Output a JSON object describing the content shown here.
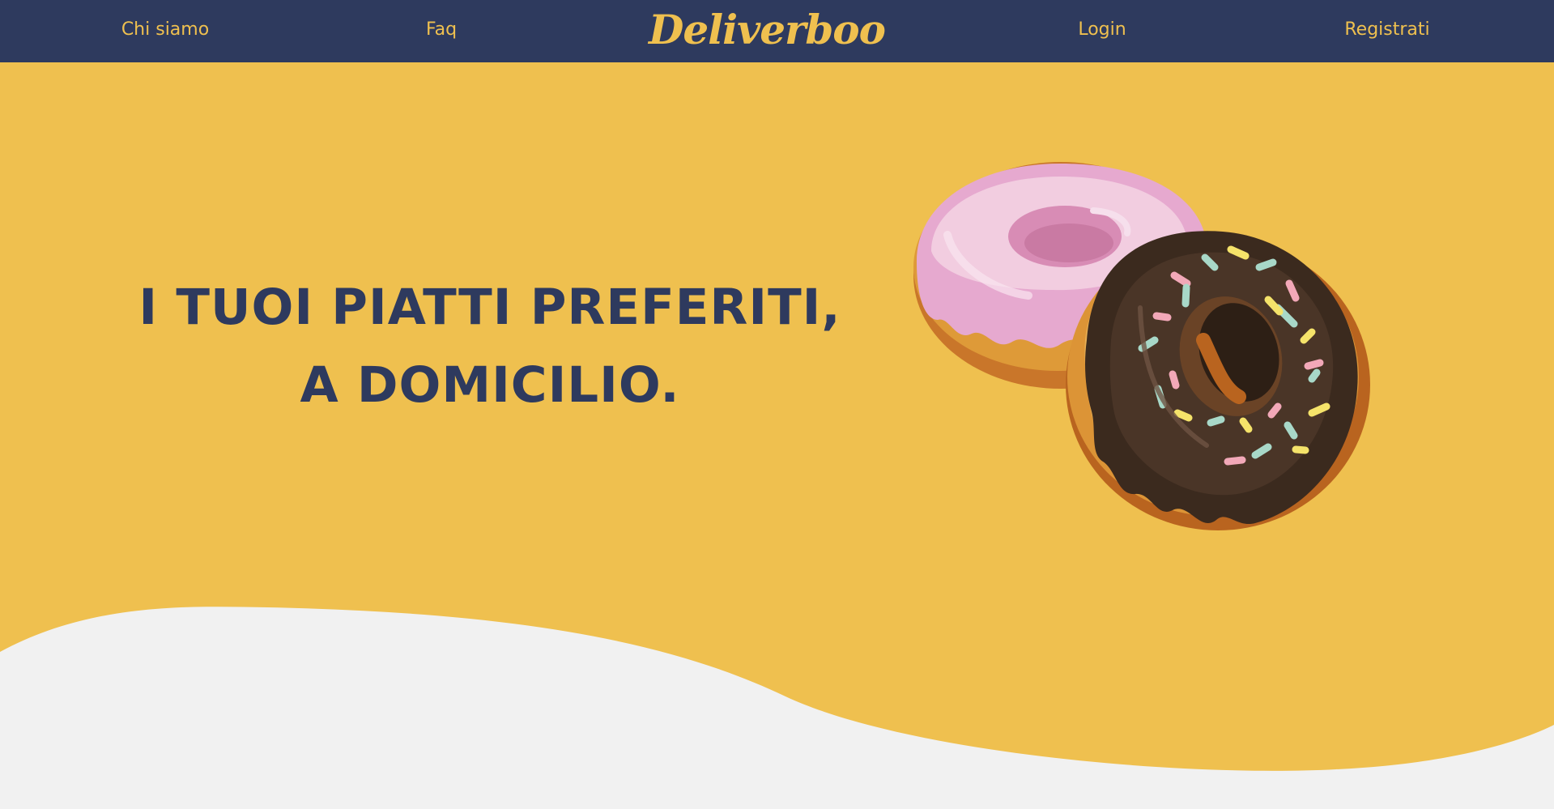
{
  "navbar": {
    "links": {
      "about": "Chi siamo",
      "faq": "Faq",
      "login": "Login",
      "register": "Registrati"
    },
    "logo": "Deliverboo"
  },
  "hero": {
    "headline_line1": "I TUOI PIATTI PREFERITI,",
    "headline_line2": "A DOMICILIO."
  },
  "colors": {
    "navbar_bg": "#2e3a5e",
    "accent_yellow": "#efc04f",
    "wave_bg": "#f1f1f1",
    "headline_text": "#2e3a5e"
  },
  "illustration": {
    "icon": "donuts-illustration"
  }
}
